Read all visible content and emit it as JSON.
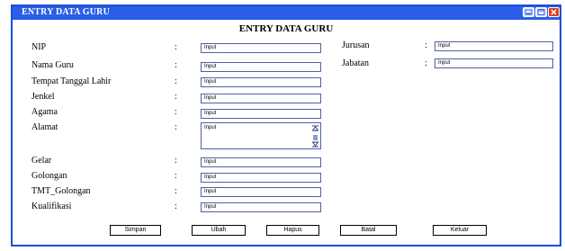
{
  "window": {
    "title": "ENTRY DATA GURU"
  },
  "form": {
    "heading": "ENTRY DATA GURU",
    "colon": ":",
    "left_fields": [
      {
        "label": "NIP",
        "value": "Input"
      },
      {
        "label": "Nama Guru",
        "value": "Input"
      },
      {
        "label": "Tempat Tanggal Lahir",
        "value": "Input"
      },
      {
        "label": "Jenkel",
        "value": "Input"
      },
      {
        "label": "Agama",
        "value": "Input"
      },
      {
        "label": "Alamat",
        "value": "Input"
      },
      {
        "label": "Gelar",
        "value": "Input"
      },
      {
        "label": "Golongan",
        "value": "Input"
      },
      {
        "label": "TMT_Golongan",
        "value": "Input"
      },
      {
        "label": "Kualifikasi",
        "value": "Input"
      }
    ],
    "right_fields": [
      {
        "label": "Jurusan",
        "value": "Input"
      },
      {
        "label": "Jabatan",
        "value": "Input"
      }
    ]
  },
  "buttons": {
    "simpan": "Simpan",
    "ubah": "Ubah",
    "hapus": "Hapus",
    "batal": "Batal",
    "keluar": "Keluar"
  },
  "colors": {
    "titlebar": "#2a5ee8",
    "border": "#1c4fd6"
  }
}
